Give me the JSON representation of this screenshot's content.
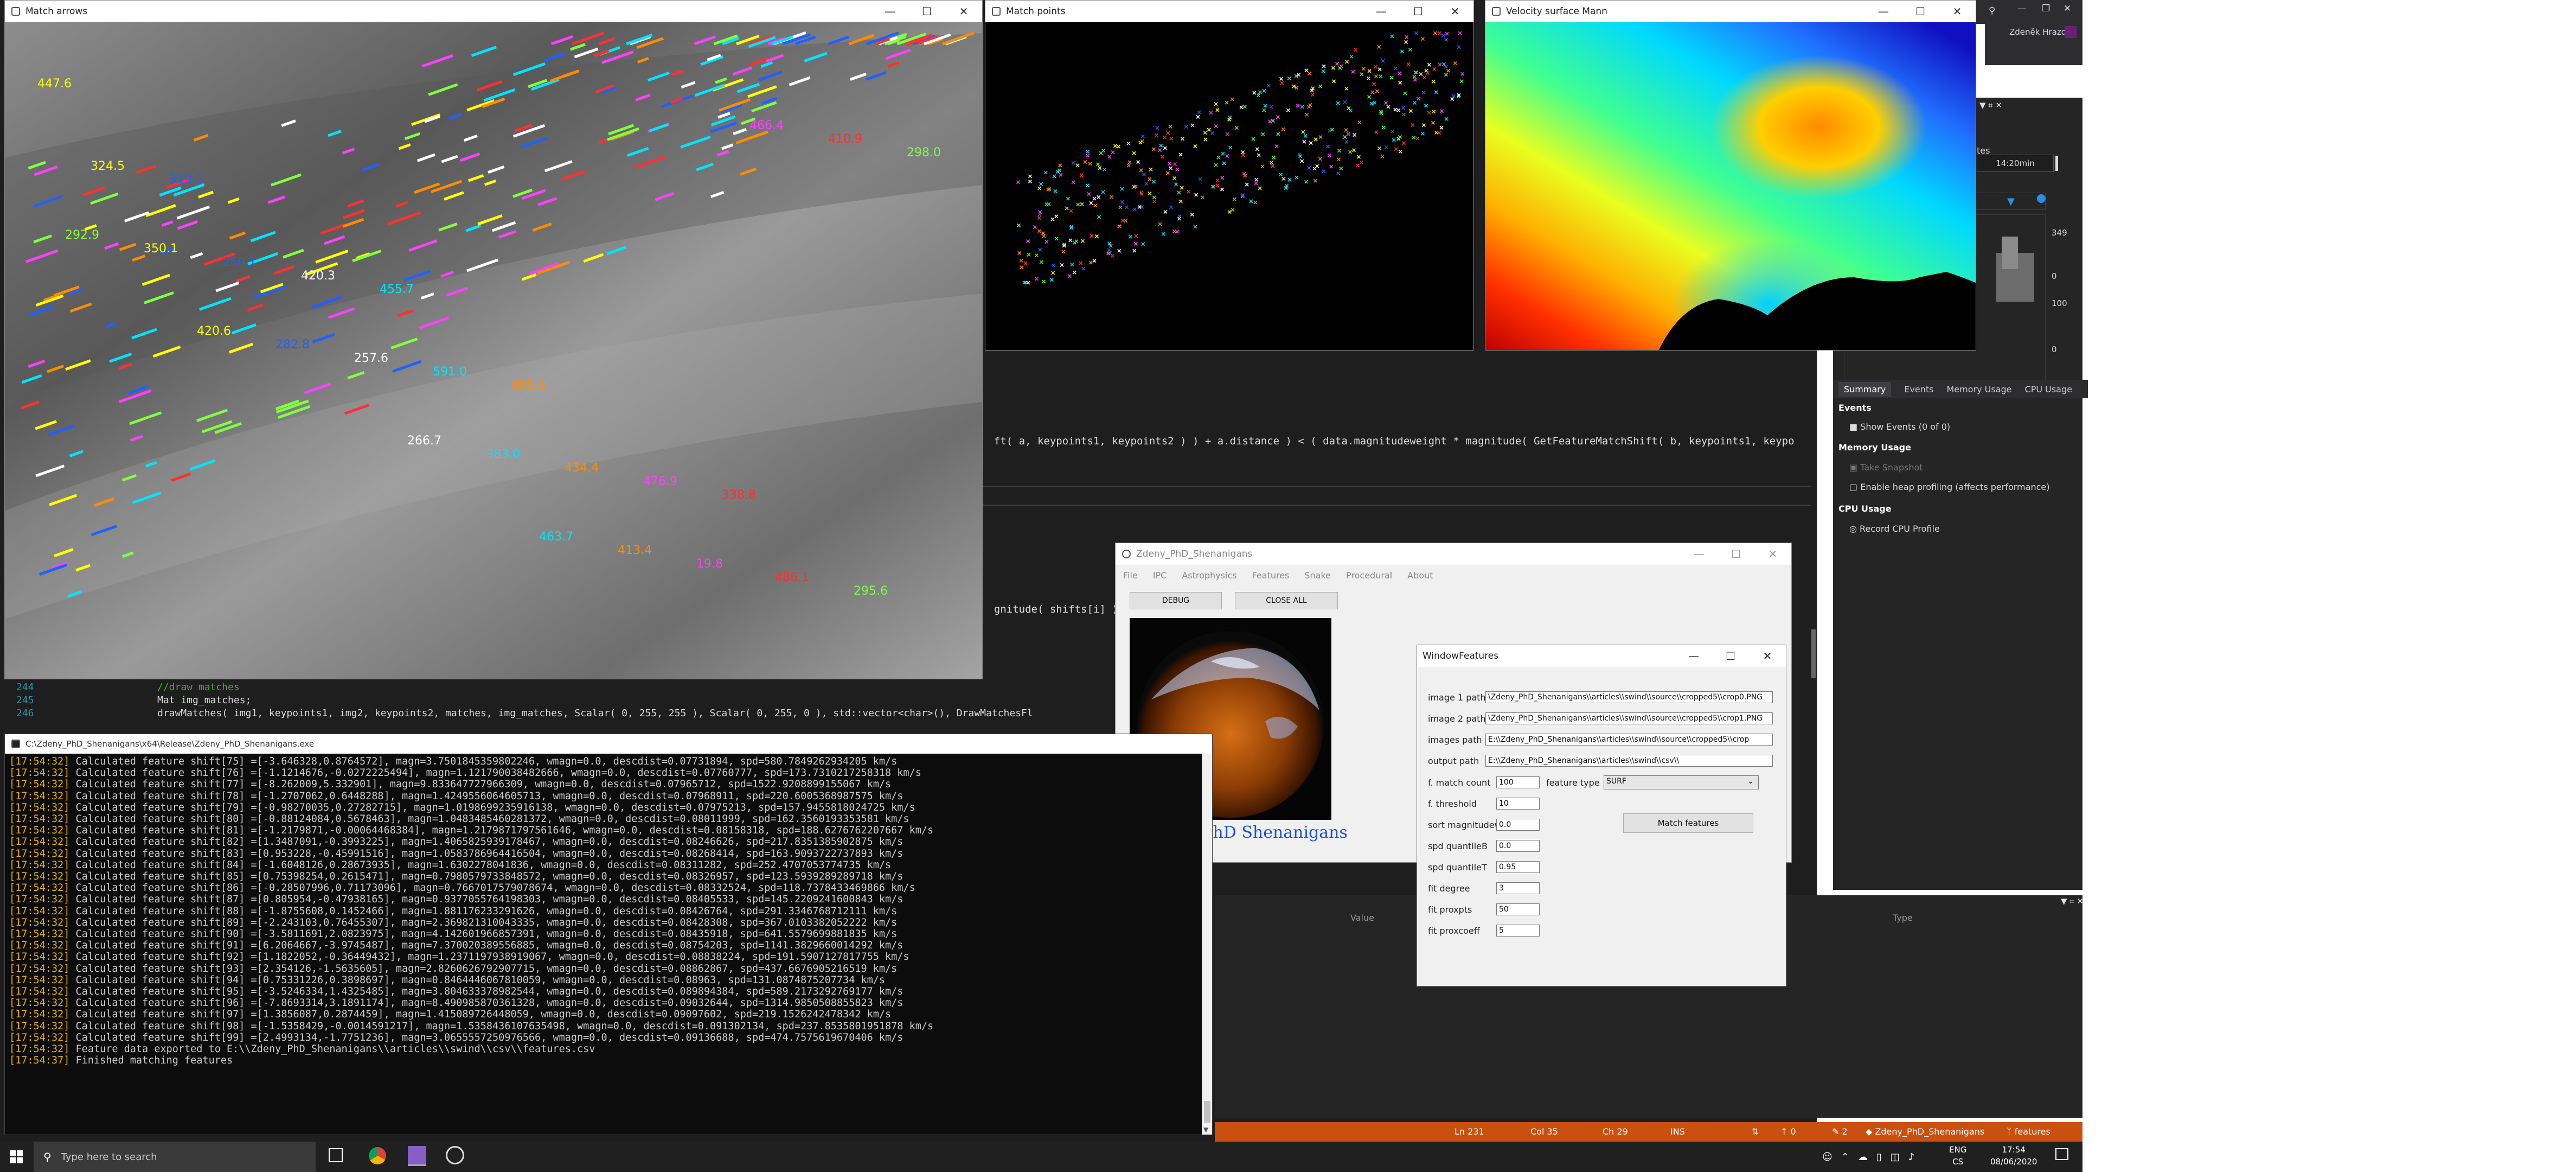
{
  "colors": {
    "vs_bg": "#1e1e1e",
    "vs_panel": "#252526",
    "status_bar": "#ca5010",
    "taskbar": "#202020",
    "console_bg": "#0c0c0c",
    "timestamp": "#e8b400",
    "link_blue": "#1a4fd6"
  },
  "windows": {
    "match_arrows": {
      "title": "Match arrows"
    },
    "match_points": {
      "title": "Match points"
    },
    "velocity": {
      "title": "Velocity surface Mann"
    },
    "console": {
      "title": "C:\\Zdeny_PhD_Shenanigans\\x64\\Release\\Zdeny_PhD_Shenanigans.exe"
    },
    "app": {
      "title": "Zdeny_PhD_Shenanigans",
      "menu": [
        "File",
        "IPC",
        "Astrophysics",
        "Features",
        "Snake",
        "Procedural",
        "About"
      ],
      "debug_label": "DEBUG",
      "close_all_label": "CLOSE ALL",
      "brand": "Zdeny's PhD Shenanigans"
    },
    "features": {
      "title": "WindowFeatures",
      "fields": [
        {
          "label": "image 1 path",
          "value": "\\Zdeny_PhD_Shenanigans\\\\articles\\\\swind\\\\source\\\\cropped5\\\\crop0.PNG"
        },
        {
          "label": "image 2 path",
          "value": "\\Zdeny_PhD_Shenanigans\\\\articles\\\\swind\\\\source\\\\cropped5\\\\crop1.PNG"
        },
        {
          "label": "images path",
          "value": "E:\\\\Zdeny_PhD_Shenanigans\\\\articles\\\\swind\\\\source\\\\cropped5\\\\crop"
        },
        {
          "label": "output path",
          "value": "E:\\\\Zdeny_PhD_Shenanigans\\\\articles\\\\swind\\\\csv\\\\"
        }
      ],
      "params": [
        {
          "label": "f. match count",
          "value": "100"
        },
        {
          "label": "f. threshold",
          "value": "10"
        },
        {
          "label": "sort magnitudew",
          "value": "0.0"
        },
        {
          "label": "spd quantileB",
          "value": "0.0"
        },
        {
          "label": "spd quantileT",
          "value": "0.95"
        },
        {
          "label": "fit degree",
          "value": "3"
        },
        {
          "label": "fit proxpts",
          "value": "50"
        },
        {
          "label": "fit proxcoeff",
          "value": "5"
        }
      ],
      "feature_type_label": "feature type",
      "feature_type_value": "SURF",
      "match_button": "Match features"
    }
  },
  "code": {
    "line1": "ft( a, keypoints1, keypoints2 ) ) + a.distance ) < ( data.magnitudeweight * magnitude( GetFeatureMatchShift( b, keypoints1, keypo",
    "line2": "gnitude( shifts[i] ),",
    "lines": [
      {
        "num": "244",
        "text": "//draw matches"
      },
      {
        "num": "245",
        "text": "Mat img_matches;"
      },
      {
        "num": "246",
        "text": "drawMatches( img1, keypoints1, img2, keypoints2, matches, img_matches, Scalar( 0, 255, 255 ), Scalar( 0, 255, 0 ), std::vector<char>(), DrawMatchesFl"
      }
    ]
  },
  "console_lines": [
    {
      "ts": "[17:54:32]",
      "msg": "Calculated feature shift[75] =[-3.646328,0.8764572], magn=3.7501845359802246, wmagn=0.0, descdist=0.07731894, spd=580.7849262934205 km/s"
    },
    {
      "ts": "[17:54:32]",
      "msg": "Calculated feature shift[76] =[-1.1214676,-0.0272225494], magn=1.121790038482666, wmagn=0.0, descdist=0.07760777, spd=173.7310217258318 km/s"
    },
    {
      "ts": "[17:54:32]",
      "msg": "Calculated feature shift[77] =[-8.262009,5.332901], magn=9.833647727966309, wmagn=0.0, descdist=0.07965712, spd=1522.9208899155067 km/s"
    },
    {
      "ts": "[17:54:32]",
      "msg": "Calculated feature shift[78] =[-1.2707062,0.6448288], magn=1.4249556064605713, wmagn=0.0, descdist=0.07968911, spd=220.6005368987575 km/s"
    },
    {
      "ts": "[17:54:32]",
      "msg": "Calculated feature shift[79] =[-0.98270035,0.27282715], magn=1.0198699235916138, wmagn=0.0, descdist=0.07975213, spd=157.9455818024725 km/s"
    },
    {
      "ts": "[17:54:32]",
      "msg": "Calculated feature shift[80] =[-0.88124084,0.5678463], magn=1.0483485460281372, wmagn=0.0, descdist=0.08011999, spd=162.3560193353581 km/s"
    },
    {
      "ts": "[17:54:32]",
      "msg": "Calculated feature shift[81] =[-1.2179871,-0.00064468384], magn=1.2179871797561646, wmagn=0.0, descdist=0.08158318, spd=188.6276762207667 km/s"
    },
    {
      "ts": "[17:54:32]",
      "msg": "Calculated feature shift[82] =[1.3487091,-0.3993225], magn=1.4065825939178467, wmagn=0.0, descdist=0.08246626, spd=217.8351385902875 km/s"
    },
    {
      "ts": "[17:54:32]",
      "msg": "Calculated feature shift[83] =[0.953228,-0.45991516], magn=1.0583786964416504, wmagn=0.0, descdist=0.08268414, spd=163.9093722737893 km/s"
    },
    {
      "ts": "[17:54:32]",
      "msg": "Calculated feature shift[84] =[-1.6048126,0.28673935], magn=1.6302278041836, wmagn=0.0, descdist=0.08311282, spd=252.4707053774735 km/s"
    },
    {
      "ts": "[17:54:32]",
      "msg": "Calculated feature shift[85] =[0.75398254,0.2615471], magn=0.7980579733848572, wmagn=0.0, descdist=0.08326957, spd=123.5939289289718 km/s"
    },
    {
      "ts": "[17:54:32]",
      "msg": "Calculated feature shift[86] =[-0.28507996,0.71173096], magn=0.7667017579078674, wmagn=0.0, descdist=0.08332524, spd=118.7378433469866 km/s"
    },
    {
      "ts": "[17:54:32]",
      "msg": "Calculated feature shift[87] =[0.805954,-0.47938165], magn=0.9377055764198303, wmagn=0.0, descdist=0.08405533, spd=145.2209241600843 km/s"
    },
    {
      "ts": "[17:54:32]",
      "msg": "Calculated feature shift[88] =[-1.8755608,0.1452466], magn=1.881176233291626, wmagn=0.0, descdist=0.08426764, spd=291.3346768712111 km/s"
    },
    {
      "ts": "[17:54:32]",
      "msg": "Calculated feature shift[89] =[-2.243103,0.76455307], magn=2.369821310043335, wmagn=0.0, descdist=0.08428308, spd=367.0103382052222 km/s"
    },
    {
      "ts": "[17:54:32]",
      "msg": "Calculated feature shift[90] =[-3.5811691,2.0823975], magn=4.142601966857391, wmagn=0.0, descdist=0.08435918, spd=641.5579699881835 km/s"
    },
    {
      "ts": "[17:54:32]",
      "msg": "Calculated feature shift[91] =[6.2064667,-3.9745487], magn=7.370020389556885, wmagn=0.0, descdist=0.08754203, spd=1141.3829660014292 km/s"
    },
    {
      "ts": "[17:54:32]",
      "msg": "Calculated feature shift[92] =[1.1822052,-0.36449432], magn=1.2371197938919067, wmagn=0.0, descdist=0.08838224, spd=191.5907127817755 km/s"
    },
    {
      "ts": "[17:54:32]",
      "msg": "Calculated feature shift[93] =[2.354126,-1.5635605], magn=2.8260626792907715, wmagn=0.0, descdist=0.08862867, spd=437.6676905216519 km/s"
    },
    {
      "ts": "[17:54:32]",
      "msg": "Calculated feature shift[94] =[0.75331226,0.3898697], magn=0.8464446067810059, wmagn=0.0, descdist=0.08963, spd=131.0874875207734 km/s"
    },
    {
      "ts": "[17:54:32]",
      "msg": "Calculated feature shift[95] =[-3.5246334,1.4325485], magn=3.804633378982544, wmagn=0.0, descdist=0.089894384, spd=589.2173292769177 km/s"
    },
    {
      "ts": "[17:54:32]",
      "msg": "Calculated feature shift[96] =[-7.8693314,3.1891174], magn=8.490985870361328, wmagn=0.0, descdist=0.09032644, spd=1314.9850508855823 km/s"
    },
    {
      "ts": "[17:54:32]",
      "msg": "Calculated feature shift[97] =[1.3856087,0.2874459], magn=1.415089726448059, wmagn=0.0, descdist=0.09097602, spd=219.1526242478342 km/s"
    },
    {
      "ts": "[17:54:32]",
      "msg": "Calculated feature shift[98] =[-1.5358429,-0.0014591217], magn=1.5358436107635498, wmagn=0.0, descdist=0.091302134, spd=237.8535801951878 km/s"
    },
    {
      "ts": "[17:54:32]",
      "msg": "Calculated feature shift[99] =[2.4993134,-1.7751236], magn=3.0655557250976566, wmagn=0.0, descdist=0.09136688, spd=474.7575619670406 km/s"
    },
    {
      "ts": "[17:54:32]",
      "msg": "Feature data exported to E:\\\\Zdeny_PhD_Shenanigans\\\\articles\\\\swind\\\\csv\\\\features.csv"
    },
    {
      "ts": "[17:54:37]",
      "msg": "Finished matching features"
    }
  ],
  "arrow_labels": [
    "447.6",
    "455.7",
    "338.8",
    "319.1",
    "495.6",
    "295.6",
    "420.3",
    "476.9",
    "324.5",
    "591.0",
    "486.1",
    "250.1",
    "434.4",
    "298.0",
    "257.6",
    "19.8",
    "350.1",
    "383.0",
    "410.9",
    "282.8",
    "413.4",
    "292.9",
    "266.7",
    "466.4",
    "420.6",
    "463.7"
  ],
  "diagnostics": {
    "time_label": "14:20min",
    "graph1_max": "349",
    "graph1_min": "0",
    "graph2_max": "100",
    "graph2_min": "0",
    "tabs": [
      "Summary",
      "Events",
      "Memory Usage",
      "CPU Usage"
    ],
    "events_heading": "Events",
    "show_events": "Show Events (0 of 0)",
    "memory_heading": "Memory Usage",
    "take_snapshot": "Take Snapshot",
    "heap_profiling": "Enable heap profiling (affects performance)",
    "cpu_heading": "CPU Usage",
    "record_cpu": "Record CPU Profile",
    "partial_label": "tes"
  },
  "user_name": "Zdeněk Hrazdira",
  "locals": {
    "value_header": "Value",
    "type_header": "Type"
  },
  "status": {
    "ln": "Ln 231",
    "col": "Col 35",
    "ch": "Ch 29",
    "ins": "INS",
    "up": "0",
    "pencil": "2",
    "repo": "Zdeny_PhD_Shenanigans",
    "branch": "features"
  },
  "taskbar": {
    "search_placeholder": "Type here to search",
    "lang1": "ENG",
    "lang2": "CS",
    "time": "17:54",
    "date": "08/06/2020"
  }
}
